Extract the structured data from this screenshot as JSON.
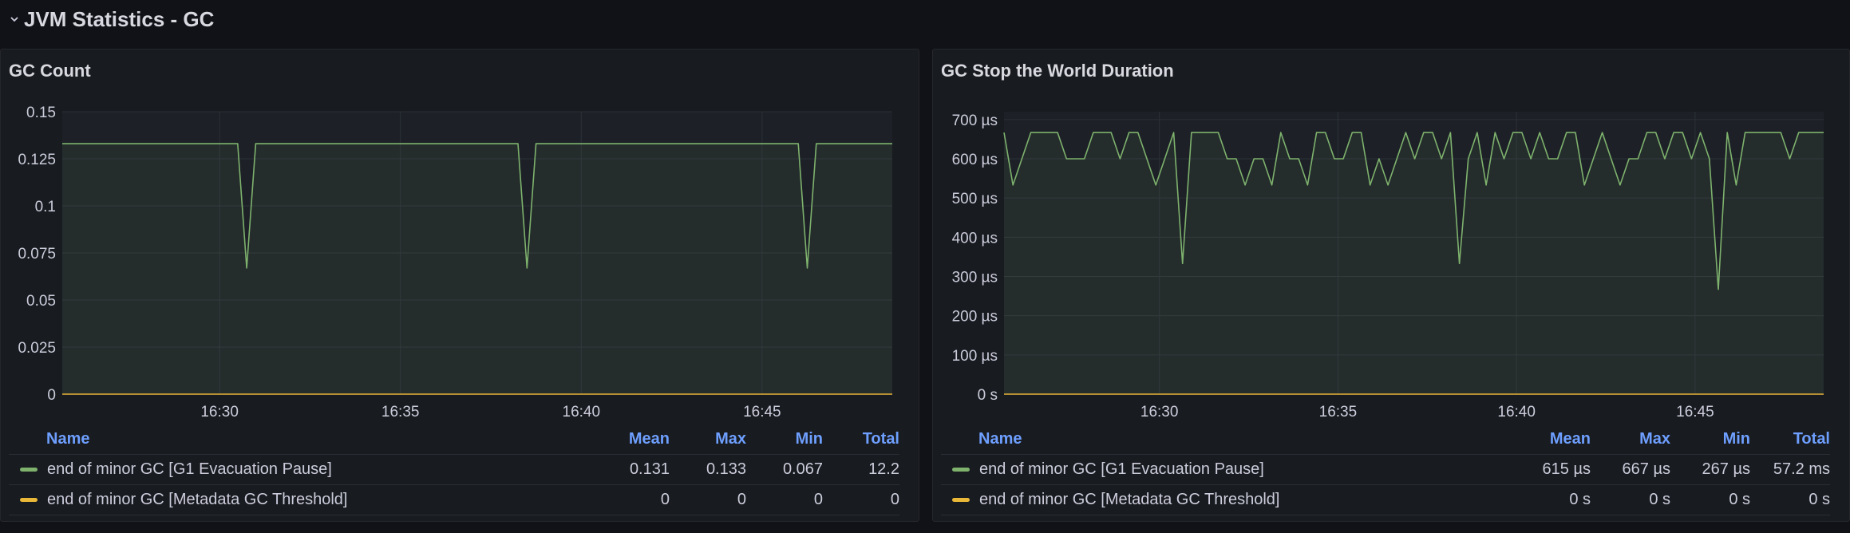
{
  "row": {
    "title": "JVM Statistics - GC"
  },
  "colors": {
    "green": "#7eb26d",
    "yellow": "#eab839",
    "grid": "#2c3037",
    "link": "#6e9fff"
  },
  "panels": [
    {
      "title": "GC Count",
      "legend": {
        "headers": {
          "name": "Name",
          "mean": "Mean",
          "max": "Max",
          "min": "Min",
          "total": "Total"
        },
        "rows": [
          {
            "name": "end of minor GC [G1 Evacuation Pause]",
            "mean": "0.131",
            "max": "0.133",
            "min": "0.067",
            "total": "12.2"
          },
          {
            "name": "end of minor GC [Metadata GC Threshold]",
            "mean": "0",
            "max": "0",
            "min": "0",
            "total": "0"
          }
        ]
      }
    },
    {
      "title": "GC Stop the World Duration",
      "legend": {
        "headers": {
          "name": "Name",
          "mean": "Mean",
          "max": "Max",
          "min": "Min",
          "total": "Total"
        },
        "rows": [
          {
            "name": "end of minor GC [G1 Evacuation Pause]",
            "mean": "615 µs",
            "max": "667 µs",
            "min": "267 µs",
            "total": "57.2 ms"
          },
          {
            "name": "end of minor GC [Metadata GC Threshold]",
            "mean": "0 s",
            "max": "0 s",
            "min": "0 s",
            "total": "0 s"
          }
        ]
      }
    }
  ],
  "chart_data": [
    {
      "type": "line",
      "title": "GC Count",
      "x_range": [
        "16:25:39",
        "16:48:36"
      ],
      "x_ticks": [
        "16:30",
        "16:35",
        "16:40",
        "16:45"
      ],
      "ylim": [
        0,
        0.15
      ],
      "y_ticks": [
        0,
        0.025,
        0.05,
        0.075,
        0.1,
        0.125,
        0.15
      ],
      "y_tick_labels": [
        "0",
        "0.025",
        "0.05",
        "0.075",
        "0.1",
        "0.125",
        "0.15"
      ],
      "grid": true,
      "legend_position": "bottom",
      "series": [
        {
          "name": "end of minor GC [G1 Evacuation Pause]",
          "color": "#7eb26d",
          "x": [
            "16:25:39",
            "16:30:30",
            "16:30:45",
            "16:31:00",
            "16:38:15",
            "16:38:30",
            "16:38:45",
            "16:46:00",
            "16:46:15",
            "16:46:30",
            "16:48:36"
          ],
          "values": [
            0.133,
            0.133,
            0.067,
            0.133,
            0.133,
            0.067,
            0.133,
            0.133,
            0.067,
            0.133,
            0.133
          ]
        },
        {
          "name": "end of minor GC [Metadata GC Threshold]",
          "color": "#eab839",
          "x": [
            "16:25:39",
            "16:48:36"
          ],
          "values": [
            0,
            0
          ]
        }
      ]
    },
    {
      "type": "line",
      "title": "GC Stop the World Duration",
      "x_range": [
        "16:25:39",
        "16:48:36"
      ],
      "x_ticks": [
        "16:30",
        "16:35",
        "16:40",
        "16:45"
      ],
      "ylim": [
        0,
        720
      ],
      "y_unit": "µs",
      "y_ticks": [
        0,
        100,
        200,
        300,
        400,
        500,
        600,
        700
      ],
      "y_tick_labels": [
        "0 s",
        "100 µs",
        "200 µs",
        "300 µs",
        "400 µs",
        "500 µs",
        "600 µs",
        "700 µs"
      ],
      "grid": true,
      "legend_position": "bottom",
      "series": [
        {
          "name": "end of minor GC [G1 Evacuation Pause]",
          "color": "#7eb26d",
          "x": [
            "16:25:39",
            "16:25:54",
            "16:26:09",
            "16:26:24",
            "16:26:39",
            "16:26:54",
            "16:27:09",
            "16:27:24",
            "16:27:39",
            "16:27:54",
            "16:28:09",
            "16:28:24",
            "16:28:39",
            "16:28:54",
            "16:29:09",
            "16:29:24",
            "16:29:39",
            "16:29:54",
            "16:30:09",
            "16:30:24",
            "16:30:39",
            "16:30:54",
            "16:31:09",
            "16:31:24",
            "16:31:39",
            "16:31:54",
            "16:32:09",
            "16:32:24",
            "16:32:39",
            "16:32:54",
            "16:33:09",
            "16:33:24",
            "16:33:39",
            "16:33:54",
            "16:34:09",
            "16:34:24",
            "16:34:39",
            "16:34:54",
            "16:35:09",
            "16:35:24",
            "16:35:39",
            "16:35:54",
            "16:36:09",
            "16:36:24",
            "16:36:39",
            "16:36:54",
            "16:37:09",
            "16:37:24",
            "16:37:39",
            "16:37:54",
            "16:38:09",
            "16:38:24",
            "16:38:39",
            "16:38:54",
            "16:39:09",
            "16:39:24",
            "16:39:39",
            "16:39:54",
            "16:40:09",
            "16:40:24",
            "16:40:39",
            "16:40:54",
            "16:41:09",
            "16:41:24",
            "16:41:39",
            "16:41:54",
            "16:42:09",
            "16:42:24",
            "16:42:39",
            "16:42:54",
            "16:43:09",
            "16:43:24",
            "16:43:39",
            "16:43:54",
            "16:44:09",
            "16:44:24",
            "16:44:39",
            "16:44:54",
            "16:45:09",
            "16:45:24",
            "16:45:39",
            "16:45:54",
            "16:46:09",
            "16:46:24",
            "16:46:39",
            "16:46:54",
            "16:47:09",
            "16:47:24",
            "16:47:39",
            "16:47:54",
            "16:48:09",
            "16:48:36"
          ],
          "values": [
            667,
            533,
            600,
            667,
            667,
            667,
            667,
            600,
            600,
            600,
            667,
            667,
            667,
            600,
            667,
            667,
            600,
            533,
            600,
            667,
            333,
            667,
            667,
            667,
            667,
            600,
            600,
            533,
            600,
            600,
            533,
            667,
            600,
            600,
            533,
            667,
            667,
            600,
            600,
            667,
            667,
            533,
            600,
            533,
            600,
            667,
            600,
            667,
            667,
            600,
            667,
            333,
            600,
            667,
            533,
            667,
            600,
            667,
            667,
            600,
            667,
            600,
            600,
            667,
            667,
            533,
            600,
            667,
            600,
            533,
            600,
            600,
            667,
            667,
            600,
            667,
            667,
            600,
            667,
            600,
            267,
            667,
            533,
            667,
            667,
            667,
            667,
            667,
            600,
            667,
            667,
            667
          ]
        },
        {
          "name": "end of minor GC [Metadata GC Threshold]",
          "color": "#eab839",
          "x": [
            "16:25:39",
            "16:48:36"
          ],
          "values": [
            0,
            0
          ]
        }
      ]
    }
  ]
}
